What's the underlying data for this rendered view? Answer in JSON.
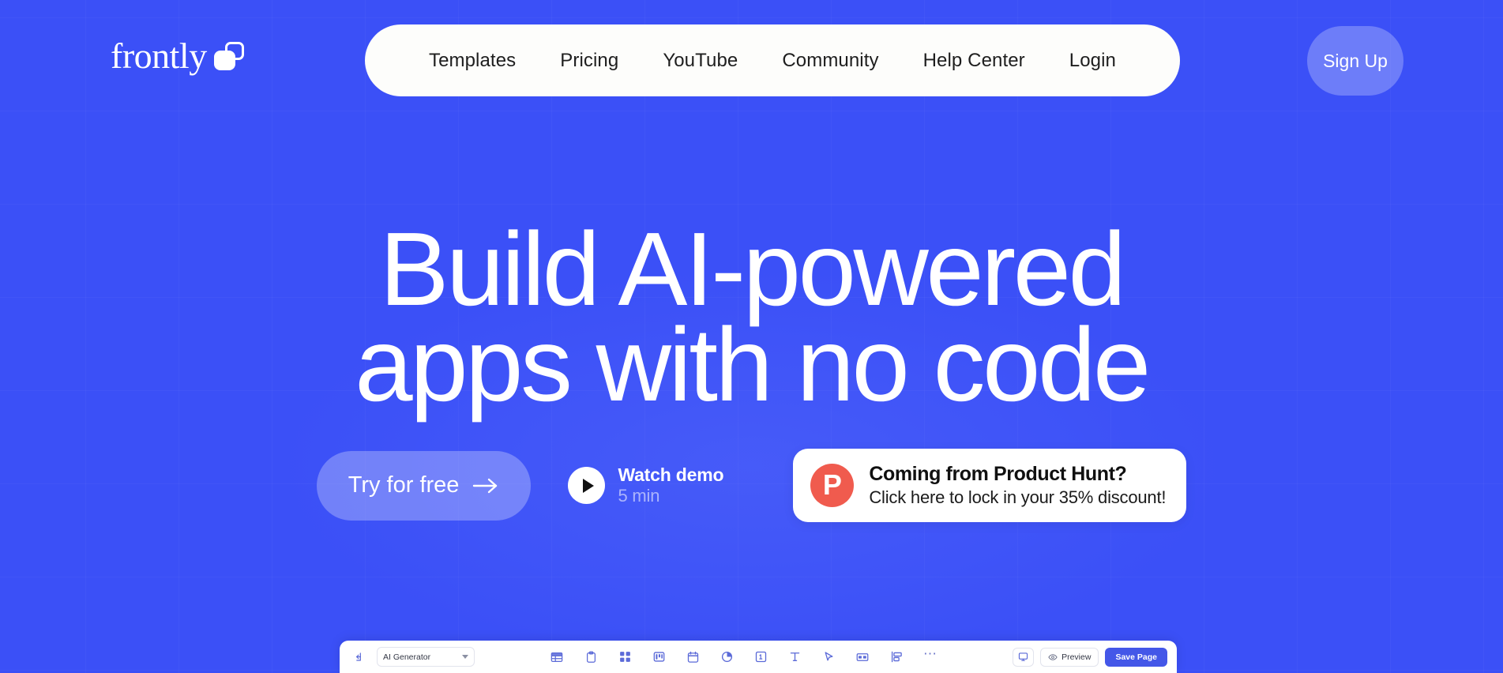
{
  "theme": {
    "background": "#3B50F7",
    "nav_pill_bg": "#FDFDFB",
    "nav_text": "#1E1E1E",
    "accent_light": "rgba(255,255,255,0.28)",
    "product_hunt_red": "#F05B4E",
    "toolbar_blue": "#4457E8",
    "toolbar_icon": "#5B6AD8"
  },
  "header": {
    "logo_word": "frontly",
    "logo_icon": "overlapping-squares-icon",
    "nav_items": [
      {
        "label": "Templates"
      },
      {
        "label": "Pricing"
      },
      {
        "label": "YouTube"
      },
      {
        "label": "Community"
      },
      {
        "label": "Help Center"
      },
      {
        "label": "Login"
      }
    ],
    "signup_label": "Sign Up"
  },
  "hero": {
    "title": "Build AI-powered\napps with no code",
    "title_line1": "Build AI-powered",
    "title_line2": "apps with no code",
    "cta_primary": "Try for free",
    "cta_primary_icon": "arrow-right-icon",
    "watch_demo": {
      "icon": "play-icon",
      "title": "Watch demo",
      "duration": "5 min"
    },
    "product_hunt": {
      "logo_letter": "P",
      "title": "Coming from Product Hunt?",
      "subtitle": "Click here to lock in your 35% discount!"
    }
  },
  "editor_toolbar": {
    "back_icon": "back-arrow-icon",
    "generator_select": {
      "value": "AI Generator",
      "options": [
        "AI Generator"
      ]
    },
    "tools": [
      {
        "name": "table-icon"
      },
      {
        "name": "clipboard-icon"
      },
      {
        "name": "grid-icon"
      },
      {
        "name": "kanban-icon"
      },
      {
        "name": "calendar-icon"
      },
      {
        "name": "pie-chart-icon"
      },
      {
        "name": "stat-box-icon"
      },
      {
        "name": "text-icon"
      },
      {
        "name": "cursor-icon"
      },
      {
        "name": "form-icon"
      },
      {
        "name": "layout-icon"
      },
      {
        "name": "more-options-icon"
      }
    ],
    "device_icon": "monitor-icon",
    "preview_label": "Preview",
    "preview_icon": "eye-icon",
    "save_label": "Save Page"
  }
}
